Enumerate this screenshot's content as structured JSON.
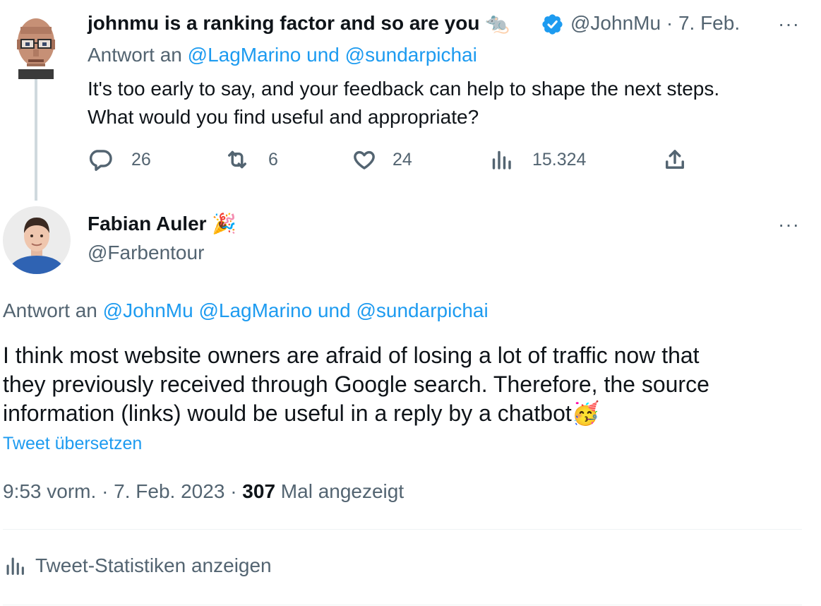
{
  "parent_tweet": {
    "display_name": "johnmu is a ranking factor and so are you",
    "name_emoji": "🐀",
    "handle": "@JohnMu",
    "separator": "·",
    "date": "7. Feb.",
    "more": "···",
    "reply_prefix": "Antwort an",
    "reply_mention_1": "@LagMarino",
    "reply_and": "und",
    "reply_mention_2": "@sundarpichai",
    "text_line_1": "It's too early to say, and your feedback can help to shape the next steps.",
    "text_line_2": "What would you find useful and appropriate?",
    "replies": "26",
    "retweets": "6",
    "likes": "24",
    "views": "15.324"
  },
  "main_tweet": {
    "display_name": "Fabian Auler",
    "name_emoji": "🎉",
    "handle": "@Farbentour",
    "more": "···",
    "reply_prefix": "Antwort an",
    "reply_mention_1": "@JohnMu",
    "reply_mention_2": "@LagMarino",
    "reply_and": "und",
    "reply_mention_3": "@sundarpichai",
    "text_line_1": "I think most website owners are afraid of losing a lot of traffic now that",
    "text_line_2": "they previously received through Google search. Therefore, the source",
    "text_line_3": "information (links) would be useful in a reply by a chatbot",
    "text_emoji": "🥳",
    "translate_link": "Tweet übersetzen",
    "time": "9:53 vorm.",
    "separator": "·",
    "date": "7. Feb. 2023",
    "view_count": "307",
    "view_label": "Mal angezeigt",
    "stats_link": "Tweet-Statistiken anzeigen"
  },
  "colors": {
    "link": "#1d9bf0",
    "secondary_text": "#536471",
    "verified": "#1d9bf0"
  }
}
